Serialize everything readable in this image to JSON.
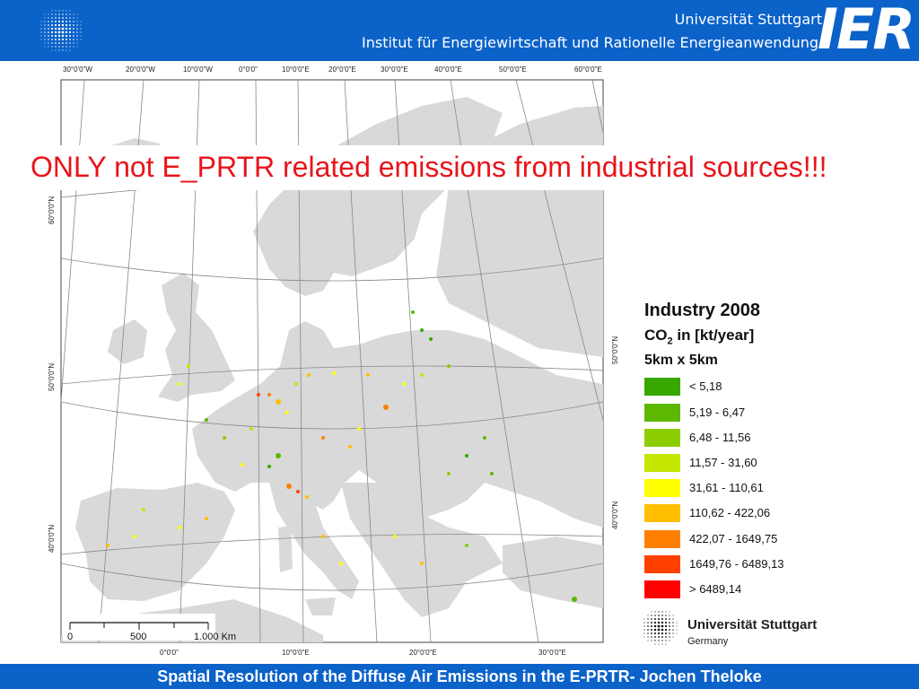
{
  "header": {
    "university": "Universität Stuttgart",
    "institute": "Institut für Energiewirtschaft und Rationelle Energieanwendung",
    "logo_text": "IER"
  },
  "banner": {
    "text": "ONLY not E_PRTR related emissions from industrial sources!!!"
  },
  "map": {
    "top_longitudes": [
      "30°0'0\"W",
      "20°0'0\"W",
      "10°0'0\"W",
      "0°0'0\"",
      "10°0'0\"E",
      "20°0'0\"E",
      "30°0'0\"E",
      "40°0'0\"E",
      "50°0'0\"E",
      "60°0'0\"E"
    ],
    "bottom_longitudes": [
      "0°0'0\"",
      "10°0'0\"E",
      "20°0'0\"E",
      "30°0'0\"E"
    ],
    "left_latitudes": [
      "60°0'0\"N",
      "50°0'0\"N",
      "40°0'0\"N"
    ],
    "right_latitudes": [
      "50°0'0\"N",
      "40°0'0\"N"
    ],
    "scale_labels": [
      "0",
      "500",
      "1.000 Km"
    ]
  },
  "legend": {
    "title": "Industry 2008",
    "unit_prefix": "CO",
    "unit_sub": "2",
    "unit_suffix": " in [kt/year]",
    "resolution": "5km x 5km",
    "classes": [
      {
        "label": "< 5,18",
        "color": "#38a800"
      },
      {
        "label": "5,19 - 6,47",
        "color": "#5cb800"
      },
      {
        "label": "6,48 - 11,56",
        "color": "#8ccd00"
      },
      {
        "label": "11,57 - 31,60",
        "color": "#c4e600"
      },
      {
        "label": "31,61 - 110,61",
        "color": "#ffff00"
      },
      {
        "label": "110,62 - 422,06",
        "color": "#ffbf00"
      },
      {
        "label": "422,07 - 1649,75",
        "color": "#ff8000"
      },
      {
        "label": "1649,76 - 6489,13",
        "color": "#ff4000"
      },
      {
        "label": "> 6489,14",
        "color": "#ff0000"
      }
    ]
  },
  "footer_logo": {
    "name": "Universität Stuttgart",
    "country": "Germany"
  },
  "footer": {
    "text": "Spatial Resolution of the Diffuse Air Emissions in the E-PRTR- Jochen Theloke"
  }
}
